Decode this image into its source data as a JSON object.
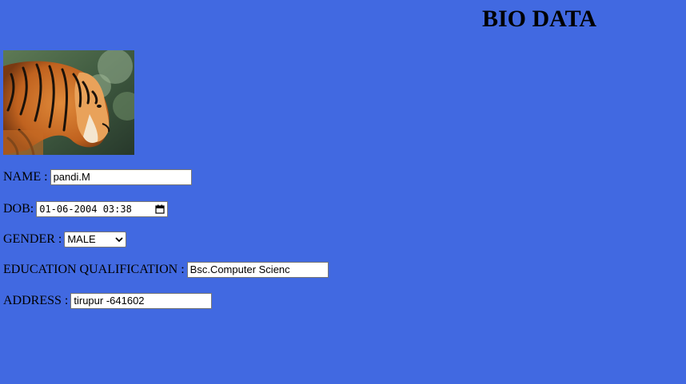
{
  "page": {
    "title": "BIO DATA"
  },
  "photo": {
    "icon": "tiger-photo"
  },
  "form": {
    "name": {
      "label": "NAME :",
      "value": "pandi.M"
    },
    "dob": {
      "label": "DOB:",
      "value": "01-06-2004 03:38"
    },
    "gender": {
      "label": "GENDER :",
      "value": "MALE"
    },
    "education": {
      "label": "EDUCATION QUALIFICATION :",
      "value": "Bsc.Computer Scienc"
    },
    "address": {
      "label": "ADDRESS :",
      "value": "tirupur -641602"
    }
  },
  "colors": {
    "background": "#4169e1"
  }
}
